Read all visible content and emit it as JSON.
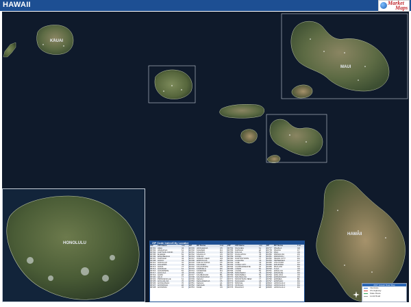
{
  "header": {
    "title": "HAWAII",
    "logo_words": [
      "Market",
      "Maps"
    ]
  },
  "map": {
    "labels": {
      "maui": "MAUI",
      "hawaii": "HAWAII",
      "kauai": "KAUAI",
      "oahu_inset": "HONOLULU"
    }
  },
  "index": {
    "title": "ZIP Code Index/City Locator",
    "headers": [
      "ZIP",
      "ZIP Name",
      "Loc"
    ],
    "columns": [
      [
        [
          "96701",
          "AIEA",
          "D4"
        ],
        [
          "96703",
          "ANAHOLA",
          "A1"
        ],
        [
          "96704",
          "CAPTAIN COOK",
          "F5"
        ],
        [
          "96705",
          "ELEELE",
          "B1"
        ],
        [
          "96706",
          "EWA BEACH",
          "D4"
        ],
        [
          "96707",
          "KAPOLEI",
          "D4"
        ],
        [
          "96708",
          "HAIKU",
          "C6"
        ],
        [
          "96710",
          "HAKALAU",
          "F6"
        ],
        [
          "96712",
          "HALEIWA",
          "D3"
        ],
        [
          "96713",
          "HANA",
          "C7"
        ],
        [
          "96714",
          "HANALEI",
          "A1"
        ],
        [
          "96716",
          "HANAPEPE",
          "B1"
        ],
        [
          "96717",
          "HAUULA",
          "D4"
        ],
        [
          "96719",
          "HAWI",
          "E6"
        ],
        [
          "96720",
          "HILO",
          "F7"
        ],
        [
          "96722",
          "PRINCEVILLE",
          "A1"
        ],
        [
          "96725",
          "HOLUALOA",
          "F5"
        ],
        [
          "96726",
          "HONAUNAU",
          "F5"
        ],
        [
          "96727",
          "HONOKAA",
          "E6"
        ],
        [
          "96728",
          "HONOMU",
          "F6"
        ]
      ],
      [
        [
          "96729",
          "HOOLEHUA",
          "C5"
        ],
        [
          "96730",
          "KAAAWA",
          "D4"
        ],
        [
          "96731",
          "KAHUKU",
          "D3"
        ],
        [
          "96732",
          "KAHULUI",
          "C6"
        ],
        [
          "96734",
          "KAILUA",
          "D4"
        ],
        [
          "96737",
          "OCEAN VIEW",
          "G5"
        ],
        [
          "96738",
          "WAIKOLOA",
          "E5"
        ],
        [
          "96740",
          "KAILUA KONA",
          "F5"
        ],
        [
          "96741",
          "KALAHEO",
          "B1"
        ],
        [
          "96742",
          "KALAUPAPA",
          "C5"
        ],
        [
          "96743",
          "KAMUELA",
          "E6"
        ],
        [
          "96744",
          "KANEOHE",
          "D4"
        ],
        [
          "96746",
          "KAPAA",
          "A1"
        ],
        [
          "96747",
          "KAUMAKANI",
          "B1"
        ],
        [
          "96748",
          "KAUNAKAKAI",
          "C5"
        ],
        [
          "96749",
          "KEAAU",
          "F7"
        ],
        [
          "96750",
          "KEALAKEKUA",
          "F5"
        ],
        [
          "96751",
          "KEALIA",
          "A1"
        ],
        [
          "96752",
          "KEKAHA",
          "B1"
        ],
        [
          "96753",
          "KIHEI",
          "C6"
        ]
      ],
      [
        [
          "96754",
          "KILAUEA",
          "A1"
        ],
        [
          "96755",
          "KAPAAU",
          "E6"
        ],
        [
          "96756",
          "KOLOA",
          "B1"
        ],
        [
          "96757",
          "KUALAPUU",
          "C5"
        ],
        [
          "96759",
          "KUNIA",
          "D4"
        ],
        [
          "96760",
          "KURTISTOWN",
          "F7"
        ],
        [
          "96761",
          "LAHAINA",
          "C6"
        ],
        [
          "96762",
          "LAIE",
          "D3"
        ],
        [
          "96763",
          "LANAI CITY",
          "C5"
        ],
        [
          "96764",
          "LAUPAHOEHOE",
          "F6"
        ],
        [
          "96765",
          "LAWAI",
          "B1"
        ],
        [
          "96766",
          "LIHUE",
          "B1"
        ],
        [
          "96768",
          "MAKAWAO",
          "C6"
        ],
        [
          "96769",
          "MAKAWELI",
          "B1"
        ],
        [
          "96770",
          "MAUNALOA",
          "C5"
        ],
        [
          "96771",
          "MOUNTAIN VIEW",
          "F7"
        ],
        [
          "96772",
          "NAALEHU",
          "G6"
        ],
        [
          "96773",
          "NINOLE",
          "F6"
        ],
        [
          "96774",
          "OOKALA",
          "F6"
        ],
        [
          "96776",
          "PAAUILO",
          "E6"
        ]
      ],
      [
        [
          "96777",
          "PAHALA",
          "G6"
        ],
        [
          "96778",
          "PAHOA",
          "F7"
        ],
        [
          "96779",
          "PAIA",
          "C6"
        ],
        [
          "96780",
          "PAPAALOA",
          "F6"
        ],
        [
          "96781",
          "PAPAIKOU",
          "F7"
        ],
        [
          "96782",
          "PEARL CITY",
          "D4"
        ],
        [
          "96783",
          "PEPEEKEO",
          "F7"
        ],
        [
          "96785",
          "VOLCANO",
          "G7"
        ],
        [
          "96786",
          "WAHIAWA",
          "D4"
        ],
        [
          "96789",
          "MILILANI",
          "D4"
        ],
        [
          "96790",
          "KULA",
          "C6"
        ],
        [
          "96791",
          "WAIALUA",
          "D3"
        ],
        [
          "96792",
          "WAIANAE",
          "D3"
        ],
        [
          "96793",
          "WAILUKU",
          "C6"
        ],
        [
          "96795",
          "WAIMANALO",
          "D4"
        ],
        [
          "96796",
          "WAIMEA",
          "B1"
        ],
        [
          "96797",
          "WAIPAHU",
          "D4"
        ],
        [
          "96813",
          "HONOLULU",
          "D4"
        ],
        [
          "96814",
          "HONOLULU",
          "D4"
        ],
        [
          "96815",
          "HONOLULU",
          "D4"
        ]
      ]
    ]
  },
  "legend": {
    "title": "2017 Hawaii Road Map",
    "items": [
      {
        "label": "Interstate",
        "color": "#2d6fd1"
      },
      {
        "label": "US Highway",
        "color": "#d84343"
      },
      {
        "label": "State Route",
        "color": "#2fa35a"
      },
      {
        "label": "Local Road",
        "color": "#9a9a9a"
      }
    ]
  },
  "colors": {
    "header": "#1d4f93",
    "ocean": "#0f1a2b",
    "land_dark": "#4b5d3a",
    "land_mid": "#7b7a55",
    "land_light": "#a39f7e"
  }
}
